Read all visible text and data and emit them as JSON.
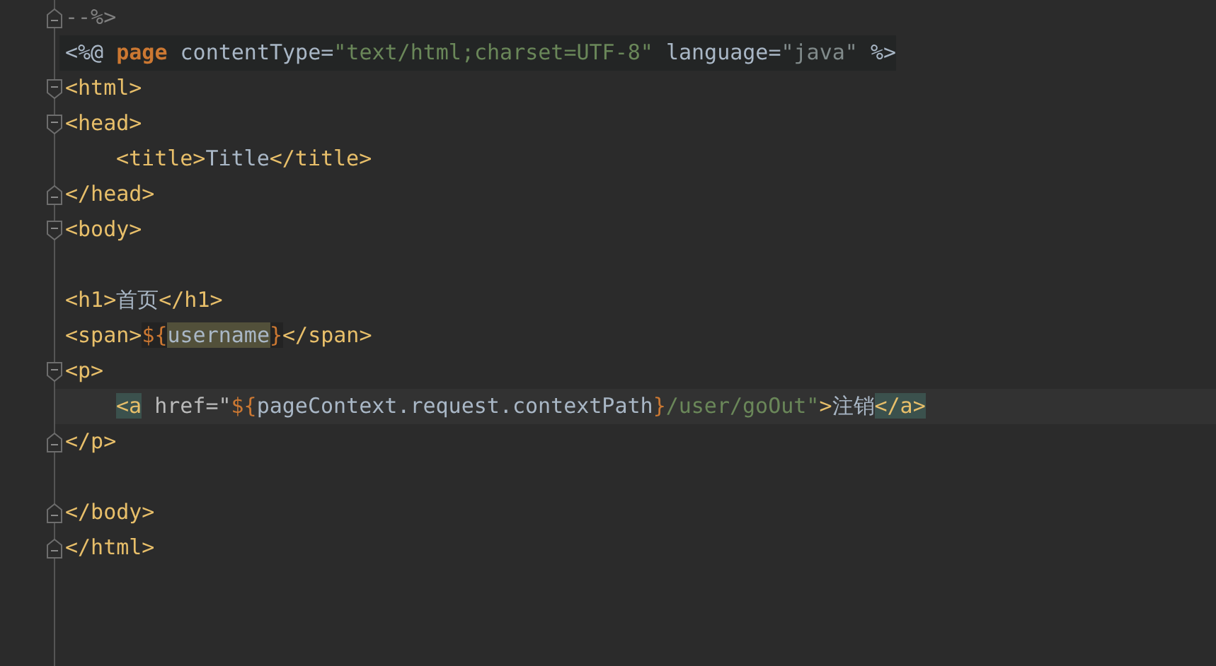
{
  "editor": {
    "lines": [
      {
        "kind": "code",
        "fold_end": true,
        "tokens": [
          {
            "text": "--%>",
            "kind": "comment"
          }
        ]
      },
      {
        "kind": "code",
        "directive": true,
        "tokens": [
          {
            "text": "<%@ ",
            "kind": "plain"
          },
          {
            "text": "page",
            "kind": "keyword"
          },
          {
            "text": " contentType=",
            "kind": "plain"
          },
          {
            "text": "\"text/html;charset=UTF-8\"",
            "kind": "string"
          },
          {
            "text": " language=",
            "kind": "plain"
          },
          {
            "text": "\"java\"",
            "kind": "value"
          },
          {
            "text": " %>",
            "kind": "plain"
          }
        ]
      },
      {
        "kind": "code",
        "fold_start": true,
        "tokens": [
          {
            "text": "<html>",
            "kind": "tag"
          }
        ]
      },
      {
        "kind": "code",
        "fold_start": true,
        "tokens": [
          {
            "text": "<head>",
            "kind": "tag"
          }
        ]
      },
      {
        "kind": "code",
        "indented": true,
        "tokens": [
          {
            "text": "<title>",
            "kind": "tag"
          },
          {
            "text": "Title",
            "kind": "text"
          },
          {
            "text": "</title>",
            "kind": "tag"
          }
        ]
      },
      {
        "kind": "code",
        "fold_end": true,
        "tokens": [
          {
            "text": "</head>",
            "kind": "tag"
          }
        ]
      },
      {
        "kind": "code",
        "fold_start": true,
        "tokens": [
          {
            "text": "<body>",
            "kind": "tag"
          }
        ]
      },
      {
        "kind": "blank"
      },
      {
        "kind": "code",
        "tokens": [
          {
            "text": "<h1>",
            "kind": "tag"
          },
          {
            "text": "首页",
            "kind": "text"
          },
          {
            "text": "</h1>",
            "kind": "tag"
          }
        ]
      },
      {
        "kind": "code",
        "tokens": [
          {
            "text": "<span>",
            "kind": "tag"
          },
          {
            "text": "${",
            "kind": "el",
            "brace_highlight": true
          },
          {
            "text": "username",
            "kind": "text",
            "identifier_highlight": true
          },
          {
            "text": "}",
            "kind": "el",
            "brace_highlight": true
          },
          {
            "text": "</span>",
            "kind": "tag"
          }
        ]
      },
      {
        "kind": "code",
        "fold_start": true,
        "tokens": [
          {
            "text": "<p>",
            "kind": "tag"
          }
        ]
      },
      {
        "kind": "code",
        "current": true,
        "indented": true,
        "tokens": [
          {
            "text": "<a",
            "kind": "tag",
            "tag_match": true
          },
          {
            "text": " href=\"",
            "kind": "attr"
          },
          {
            "text": "${",
            "kind": "el"
          },
          {
            "text": "pageContext.request.contextPath",
            "kind": "text"
          },
          {
            "text": "}",
            "kind": "el"
          },
          {
            "text": "/user/goOut\"",
            "kind": "string"
          },
          {
            "text": ">",
            "kind": "tag"
          },
          {
            "text": "注销",
            "kind": "text"
          },
          {
            "text": "</a>",
            "kind": "tag",
            "tag_match": true
          }
        ]
      },
      {
        "kind": "code",
        "fold_end": true,
        "tokens": [
          {
            "text": "</p>",
            "kind": "tag"
          }
        ]
      },
      {
        "kind": "blank"
      },
      {
        "kind": "code",
        "fold_end": true,
        "tokens": [
          {
            "text": "</body>",
            "kind": "tag"
          }
        ]
      },
      {
        "kind": "code",
        "fold_end": true,
        "tokens": [
          {
            "text": "</html>",
            "kind": "tag"
          }
        ]
      }
    ]
  }
}
